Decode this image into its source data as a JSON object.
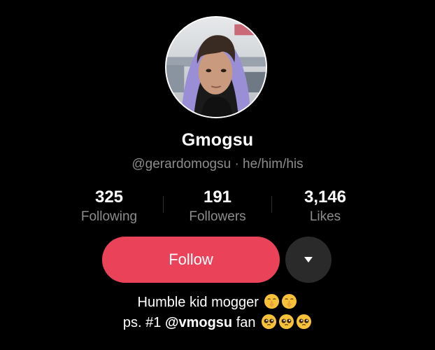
{
  "profile": {
    "display_name": "Gmogsu",
    "handle": "@gerardomogsu",
    "separator": "·",
    "pronouns": "he/him/his"
  },
  "stats": {
    "following": {
      "value": "325",
      "label": "Following"
    },
    "followers": {
      "value": "191",
      "label": "Followers"
    },
    "likes": {
      "value": "3,146",
      "label": "Likes"
    }
  },
  "actions": {
    "follow_label": "Follow",
    "more_icon": "caret-down-icon"
  },
  "bio": {
    "line1_text": "Humble kid mogger",
    "line1_emojis": [
      "shushing-face",
      "shushing-face"
    ],
    "line2_prefix": "ps. #1",
    "line2_mention": "@vmogsu",
    "line2_suffix": "fan",
    "line2_emojis": [
      "pleading-face",
      "pleading-face",
      "pleading-face"
    ]
  },
  "colors": {
    "background": "#000000",
    "follow_button": "#ea4359",
    "secondary_text": "#8c8c8c",
    "more_button": "#2a2a2a"
  }
}
